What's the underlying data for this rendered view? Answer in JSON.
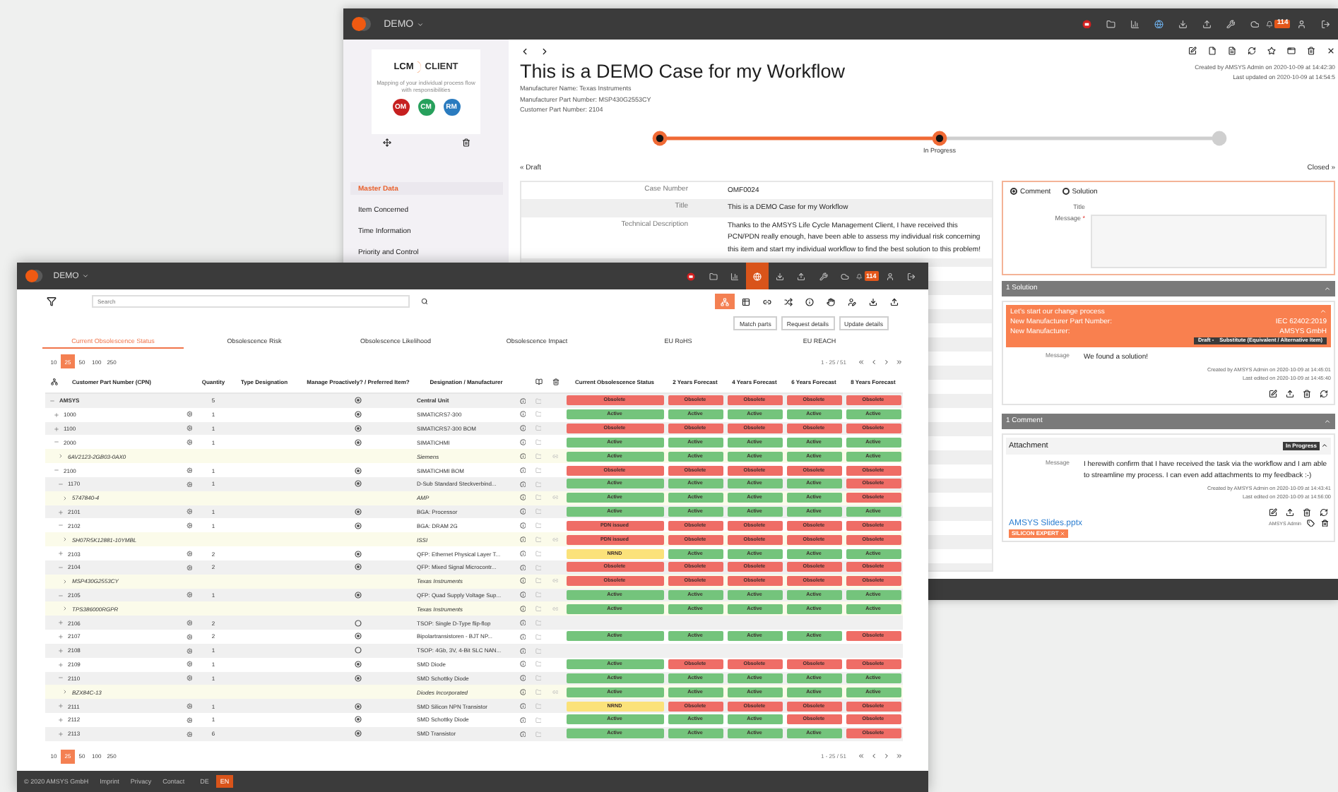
{
  "back_window": {
    "app_name": "DEMO",
    "notifications": "114",
    "logo": {
      "brand": "LCM",
      "product": "CLIENT",
      "tagline": "Mapping of your individual process flow with responsibilities",
      "modules": [
        "OM",
        "CM",
        "RM"
      ]
    },
    "menu": [
      {
        "label": "Master Data",
        "selected": true
      },
      {
        "label": "Item Concerned",
        "selected": false
      },
      {
        "label": "Time Information",
        "selected": false
      },
      {
        "label": "Priority and Control",
        "selected": false
      }
    ],
    "title": "This is a DEMO Case for my Workflow",
    "meta": [
      "Manufacturer Name: Texas Instruments",
      "Manufacturer Part Number: MSP430G2553CY",
      "Customer Part Number: 2104"
    ],
    "audit": [
      "Created by AMSYS Admin on 2020-10-09 at 14:42:30",
      "Last updated on 2020-10-09 at 14:54:5"
    ],
    "stepper": {
      "steps": [
        {
          "done": true
        },
        {
          "done": true,
          "label": "In Progress"
        },
        {
          "done": false
        }
      ],
      "previous": "« Draft",
      "next": "Closed »"
    },
    "details": [
      {
        "label": "Case Number",
        "value": "OMF0024"
      },
      {
        "label": "Title",
        "value": "This is a DEMO Case for my Workflow"
      },
      {
        "label": "Technical Description",
        "value": "Thanks to the AMSYS Life Cycle Management Client, I have received this PCN/PDN really enough, have been able to assess my individual risk concerning this item and start my individual workflow to find the best solution to this problem!"
      }
    ],
    "comment_form": {
      "options": [
        {
          "label": "Comment",
          "selected": true
        },
        {
          "label": "Solution",
          "selected": false
        }
      ],
      "fields": [
        {
          "label": "Title"
        },
        {
          "label": "Message",
          "required_mark": "*"
        }
      ]
    },
    "solutions": {
      "header": "1 Solution",
      "items": [
        {
          "title": "Let's start our change process",
          "fields": [
            {
              "label": "New Manufacturer Part Number:",
              "value": "IEC 62402:2019"
            },
            {
              "label": "New Manufacturer:",
              "value": "AMSYS GmbH"
            }
          ],
          "status": "Draft -",
          "type": "Substitute (Equivalent / Alternative Item)",
          "message_label": "Message",
          "message": "We found a solution!",
          "created": "Created by AMSYS Admin on 2020-10-09 at 14:45:01",
          "edited": "Last edited on 2020-10-09 at 14:45:40"
        }
      ]
    },
    "comments": {
      "header": "1 Comment",
      "items": [
        {
          "title": "Attachment",
          "status": "In Progress",
          "message_label": "Message",
          "message": "I herewith confirm that I have received the task via the workflow and I am able to streamline my process. I can even add attachments to my feedback :-)",
          "created": "Created by AMSYS Admin on 2020-10-09 at 14:43:41",
          "edited": "Last edited on 2020-10-09 at 14:56:00",
          "attachment": {
            "file": "AMSYS Slides.pptx",
            "author": "AMSYS Admin",
            "tag": "SILICON EXPERT"
          }
        }
      ]
    }
  },
  "front_window": {
    "app_name": "DEMO",
    "nav": [
      {
        "selected": false
      },
      {
        "selected": false
      },
      {
        "selected": false
      },
      {
        "selected": true
      },
      {
        "selected": false
      },
      {
        "selected": false
      },
      {
        "selected": false
      },
      {
        "selected": false
      },
      {
        "selected": false,
        "badge": "114"
      },
      {
        "selected": false
      },
      {
        "selected": false
      }
    ],
    "search": {
      "placeholder": "Search"
    },
    "tools": [
      {
        "selected": true
      },
      {
        "selected": false
      },
      {
        "selected": false
      },
      {
        "selected": false
      },
      {
        "selected": false
      },
      {
        "selected": false
      },
      {
        "selected": false
      },
      {
        "selected": false
      },
      {
        "selected": false
      }
    ],
    "actions": [
      "Match parts",
      "Request details",
      "Update details"
    ],
    "tabs": [
      {
        "label": "Current Obsolescence Status",
        "selected": true
      },
      {
        "label": "Obsolescence Risk",
        "selected": false
      },
      {
        "label": "Obsolescence Likelihood",
        "selected": false
      },
      {
        "label": "Obsolescence Impact",
        "selected": false
      },
      {
        "label": "EU RoHS",
        "selected": false
      },
      {
        "label": "EU REACH",
        "selected": false
      }
    ],
    "pagers": [
      {
        "sizes": [
          {
            "label": "10",
            "selected": false
          },
          {
            "label": "25",
            "selected": true
          },
          {
            "label": "50",
            "selected": false
          },
          {
            "label": "100",
            "selected": false
          },
          {
            "label": "250",
            "selected": false
          }
        ],
        "range": "1 - 25 / 51"
      },
      {
        "sizes": [
          {
            "label": "10",
            "selected": false
          },
          {
            "label": "25",
            "selected": true
          },
          {
            "label": "50",
            "selected": false
          },
          {
            "label": "100",
            "selected": false
          },
          {
            "label": "250",
            "selected": false
          }
        ],
        "range": "1 - 25 / 51"
      }
    ],
    "table": {
      "columns": [
        "Customer Part Number (CPN)",
        "Quantity",
        "Type Designation",
        "Manage Proactively? / Preferred Item?",
        "Designation / Manufacturer",
        "Current Obsolescence Status",
        "2 Years Forecast",
        "4 Years Forecast",
        "6 Years Forecast",
        "8 Years Forecast"
      ],
      "rows": [
        {
          "kind": "part",
          "cpn": "AMSYS",
          "expanded": true,
          "quantity": "5",
          "preferred": true,
          "designation": "Central Unit",
          "statuses": [
            {
              "label": "Obsolete",
              "kind": "bad"
            },
            {
              "label": "Obsolete",
              "kind": "bad"
            },
            {
              "label": "Obsolete",
              "kind": "bad"
            },
            {
              "label": "Obsolete",
              "kind": "bad"
            },
            {
              "label": "Obsolete",
              "kind": "bad"
            }
          ],
          "children": [
            {
              "kind": "part",
              "cpn": "1000",
              "expanded": false,
              "quantity": "1",
              "preferred": true,
              "designation": "SIMATICRS7-300",
              "statuses": [
                {
                  "label": "Active",
                  "kind": "good"
                },
                {
                  "label": "Active",
                  "kind": "good"
                },
                {
                  "label": "Active",
                  "kind": "good"
                },
                {
                  "label": "Active",
                  "kind": "good"
                },
                {
                  "label": "Active",
                  "kind": "good"
                }
              ]
            },
            {
              "kind": "part",
              "cpn": "1100",
              "expanded": false,
              "quantity": "1",
              "preferred": true,
              "designation": "SIMATICRS7-300 BOM",
              "statuses": [
                {
                  "label": "Obsolete",
                  "kind": "bad"
                },
                {
                  "label": "Obsolete",
                  "kind": "bad"
                },
                {
                  "label": "Obsolete",
                  "kind": "bad"
                },
                {
                  "label": "Obsolete",
                  "kind": "bad"
                },
                {
                  "label": "Obsolete",
                  "kind": "bad"
                }
              ]
            },
            {
              "kind": "part",
              "cpn": "2000",
              "expanded": true,
              "quantity": "1",
              "preferred": true,
              "designation": "SIMATICHMI",
              "statuses": [
                {
                  "label": "Active",
                  "kind": "good"
                },
                {
                  "label": "Active",
                  "kind": "good"
                },
                {
                  "label": "Active",
                  "kind": "good"
                },
                {
                  "label": "Active",
                  "kind": "good"
                },
                {
                  "label": "Active",
                  "kind": "good"
                }
              ],
              "children": [
                {
                  "kind": "manufacturer",
                  "cpn": "6AV2123-2GB03-0AX0",
                  "designation": "Siemens",
                  "statuses": [
                    {
                      "label": "Active",
                      "kind": "good"
                    },
                    {
                      "label": "Active",
                      "kind": "good"
                    },
                    {
                      "label": "Active",
                      "kind": "good"
                    },
                    {
                      "label": "Active",
                      "kind": "good"
                    },
                    {
                      "label": "Active",
                      "kind": "good"
                    }
                  ]
                }
              ]
            },
            {
              "kind": "part",
              "cpn": "2100",
              "expanded": true,
              "quantity": "1",
              "preferred": true,
              "designation": "SIMATICHMI BOM",
              "statuses": [
                {
                  "label": "Obsolete",
                  "kind": "bad"
                },
                {
                  "label": "Obsolete",
                  "kind": "bad"
                },
                {
                  "label": "Obsolete",
                  "kind": "bad"
                },
                {
                  "label": "Obsolete",
                  "kind": "bad"
                },
                {
                  "label": "Obsolete",
                  "kind": "bad"
                }
              ],
              "children": [
                {
                  "kind": "part",
                  "cpn": "1170",
                  "expanded": true,
                  "quantity": "1",
                  "preferred": true,
                  "designation": "D-Sub Standard Steckverbind...",
                  "statuses": [
                    {
                      "label": "Active",
                      "kind": "good"
                    },
                    {
                      "label": "Active",
                      "kind": "good"
                    },
                    {
                      "label": "Active",
                      "kind": "good"
                    },
                    {
                      "label": "Active",
                      "kind": "good"
                    },
                    {
                      "label": "Obsolete",
                      "kind": "bad"
                    }
                  ],
                  "children": [
                    {
                      "kind": "manufacturer",
                      "cpn": "5747840-4",
                      "designation": "AMP",
                      "statuses": [
                        {
                          "label": "Active",
                          "kind": "good"
                        },
                        {
                          "label": "Active",
                          "kind": "good"
                        },
                        {
                          "label": "Active",
                          "kind": "good"
                        },
                        {
                          "label": "Active",
                          "kind": "good"
                        },
                        {
                          "label": "Obsolete",
                          "kind": "bad"
                        }
                      ]
                    }
                  ]
                },
                {
                  "kind": "part",
                  "cpn": "2101",
                  "expanded": false,
                  "quantity": "1",
                  "preferred": true,
                  "designation": "BGA: Processor",
                  "statuses": [
                    {
                      "label": "Active",
                      "kind": "good"
                    },
                    {
                      "label": "Active",
                      "kind": "good"
                    },
                    {
                      "label": "Active",
                      "kind": "good"
                    },
                    {
                      "label": "Active",
                      "kind": "good"
                    },
                    {
                      "label": "Active",
                      "kind": "good"
                    }
                  ]
                },
                {
                  "kind": "part",
                  "cpn": "2102",
                  "expanded": true,
                  "quantity": "1",
                  "preferred": true,
                  "designation": "BGA: DRAM 2G",
                  "statuses": [
                    {
                      "label": "PDN issued",
                      "kind": "bad"
                    },
                    {
                      "label": "Obsolete",
                      "kind": "bad"
                    },
                    {
                      "label": "Obsolete",
                      "kind": "bad"
                    },
                    {
                      "label": "Obsolete",
                      "kind": "bad"
                    },
                    {
                      "label": "Obsolete",
                      "kind": "bad"
                    }
                  ],
                  "children": [
                    {
                      "kind": "manufacturer",
                      "cpn": "SH07R5K12881-10YMBL",
                      "designation": "ISSI",
                      "statuses": [
                        {
                          "label": "PDN issued",
                          "kind": "bad"
                        },
                        {
                          "label": "Obsolete",
                          "kind": "bad"
                        },
                        {
                          "label": "Obsolete",
                          "kind": "bad"
                        },
                        {
                          "label": "Obsolete",
                          "kind": "bad"
                        },
                        {
                          "label": "Obsolete",
                          "kind": "bad"
                        }
                      ]
                    }
                  ]
                },
                {
                  "kind": "part",
                  "cpn": "2103",
                  "expanded": false,
                  "quantity": "2",
                  "preferred": true,
                  "designation": "QFP: Ethernet Physical Layer T...",
                  "statuses": [
                    {
                      "label": "NRND",
                      "kind": "warn"
                    },
                    {
                      "label": "Active",
                      "kind": "good"
                    },
                    {
                      "label": "Active",
                      "kind": "good"
                    },
                    {
                      "label": "Active",
                      "kind": "good"
                    },
                    {
                      "label": "Active",
                      "kind": "good"
                    }
                  ]
                },
                {
                  "kind": "part",
                  "cpn": "2104",
                  "expanded": true,
                  "quantity": "2",
                  "preferred": true,
                  "designation": "QFP: Mixed Signal Microcontr...",
                  "statuses": [
                    {
                      "label": "Obsolete",
                      "kind": "bad"
                    },
                    {
                      "label": "Obsolete",
                      "kind": "bad"
                    },
                    {
                      "label": "Obsolete",
                      "kind": "bad"
                    },
                    {
                      "label": "Obsolete",
                      "kind": "bad"
                    },
                    {
                      "label": "Obsolete",
                      "kind": "bad"
                    }
                  ],
                  "children": [
                    {
                      "kind": "manufacturer",
                      "cpn": "MSP430G2553CY",
                      "designation": "Texas Instruments",
                      "statuses": [
                        {
                          "label": "Obsolete",
                          "kind": "bad"
                        },
                        {
                          "label": "Obsolete",
                          "kind": "bad"
                        },
                        {
                          "label": "Obsolete",
                          "kind": "bad"
                        },
                        {
                          "label": "Obsolete",
                          "kind": "bad"
                        },
                        {
                          "label": "Obsolete",
                          "kind": "bad"
                        }
                      ]
                    }
                  ]
                },
                {
                  "kind": "part",
                  "cpn": "2105",
                  "expanded": true,
                  "quantity": "1",
                  "preferred": true,
                  "designation": "QFP: Quad Supply Voltage Sup...",
                  "statuses": [
                    {
                      "label": "Active",
                      "kind": "good"
                    },
                    {
                      "label": "Active",
                      "kind": "good"
                    },
                    {
                      "label": "Active",
                      "kind": "good"
                    },
                    {
                      "label": "Active",
                      "kind": "good"
                    },
                    {
                      "label": "Active",
                      "kind": "good"
                    }
                  ],
                  "children": [
                    {
                      "kind": "manufacturer",
                      "cpn": "TPS386000RGPR",
                      "designation": "Texas Instruments",
                      "statuses": [
                        {
                          "label": "Active",
                          "kind": "good"
                        },
                        {
                          "label": "Active",
                          "kind": "good"
                        },
                        {
                          "label": "Active",
                          "kind": "good"
                        },
                        {
                          "label": "Active",
                          "kind": "good"
                        },
                        {
                          "label": "Active",
                          "kind": "good"
                        }
                      ]
                    }
                  ]
                },
                {
                  "kind": "part",
                  "cpn": "2106",
                  "expanded": false,
                  "quantity": "2",
                  "preferred": false,
                  "designation": "TSOP: Single D-Type flip-flop"
                },
                {
                  "kind": "part",
                  "cpn": "2107",
                  "expanded": false,
                  "quantity": "2",
                  "preferred": true,
                  "designation": "Bipolartransistoren - BJT NP...",
                  "statuses": [
                    {
                      "label": "Active",
                      "kind": "good"
                    },
                    {
                      "label": "Active",
                      "kind": "good"
                    },
                    {
                      "label": "Active",
                      "kind": "good"
                    },
                    {
                      "label": "Active",
                      "kind": "good"
                    },
                    {
                      "label": "Obsolete",
                      "kind": "bad"
                    }
                  ]
                },
                {
                  "kind": "part",
                  "cpn": "2108",
                  "expanded": false,
                  "quantity": "1",
                  "preferred": false,
                  "designation": "TSOP: 4Gb, 3V, 4-Bit SLC NAN..."
                },
                {
                  "kind": "part",
                  "cpn": "2109",
                  "expanded": false,
                  "quantity": "1",
                  "preferred": true,
                  "designation": "SMD Diode",
                  "statuses": [
                    {
                      "label": "Active",
                      "kind": "good"
                    },
                    {
                      "label": "Obsolete",
                      "kind": "bad"
                    },
                    {
                      "label": "Obsolete",
                      "kind": "bad"
                    },
                    {
                      "label": "Obsolete",
                      "kind": "bad"
                    },
                    {
                      "label": "Obsolete",
                      "kind": "bad"
                    }
                  ]
                },
                {
                  "kind": "part",
                  "cpn": "2110",
                  "expanded": true,
                  "quantity": "1",
                  "preferred": true,
                  "designation": "SMD Schottky Diode",
                  "statuses": [
                    {
                      "label": "Active",
                      "kind": "good"
                    },
                    {
                      "label": "Active",
                      "kind": "good"
                    },
                    {
                      "label": "Active",
                      "kind": "good"
                    },
                    {
                      "label": "Active",
                      "kind": "good"
                    },
                    {
                      "label": "Active",
                      "kind": "good"
                    }
                  ],
                  "children": [
                    {
                      "kind": "manufacturer",
                      "cpn": "BZX84C-13",
                      "designation": "Diodes Incorporated",
                      "statuses": [
                        {
                          "label": "Active",
                          "kind": "good"
                        },
                        {
                          "label": "Active",
                          "kind": "good"
                        },
                        {
                          "label": "Active",
                          "kind": "good"
                        },
                        {
                          "label": "Active",
                          "kind": "good"
                        },
                        {
                          "label": "Active",
                          "kind": "good"
                        }
                      ]
                    }
                  ]
                },
                {
                  "kind": "part",
                  "cpn": "2111",
                  "expanded": false,
                  "quantity": "1",
                  "preferred": true,
                  "designation": "SMD Silicon NPN Transistor",
                  "statuses": [
                    {
                      "label": "NRND",
                      "kind": "warn"
                    },
                    {
                      "label": "Obsolete",
                      "kind": "bad"
                    },
                    {
                      "label": "Obsolete",
                      "kind": "bad"
                    },
                    {
                      "label": "Obsolete",
                      "kind": "bad"
                    },
                    {
                      "label": "Obsolete",
                      "kind": "bad"
                    }
                  ]
                },
                {
                  "kind": "part",
                  "cpn": "2112",
                  "expanded": false,
                  "quantity": "1",
                  "preferred": true,
                  "designation": "SMD Schottky Diode",
                  "statuses": [
                    {
                      "label": "Active",
                      "kind": "good"
                    },
                    {
                      "label": "Active",
                      "kind": "good"
                    },
                    {
                      "label": "Active",
                      "kind": "good"
                    },
                    {
                      "label": "Obsolete",
                      "kind": "bad"
                    },
                    {
                      "label": "Obsolete",
                      "kind": "bad"
                    }
                  ]
                },
                {
                  "kind": "part",
                  "cpn": "2113",
                  "expanded": false,
                  "quantity": "6",
                  "preferred": true,
                  "designation": "SMD Transistor",
                  "statuses": [
                    {
                      "label": "Active",
                      "kind": "good"
                    },
                    {
                      "label": "Active",
                      "kind": "good"
                    },
                    {
                      "label": "Active",
                      "kind": "good"
                    },
                    {
                      "label": "Active",
                      "kind": "good"
                    },
                    {
                      "label": "Obsolete",
                      "kind": "bad"
                    }
                  ]
                }
              ]
            }
          ]
        }
      ]
    },
    "footer": {
      "copyright": "© 2020 AMSYS GmbH",
      "links": [
        "Imprint",
        "Privacy",
        "Contact"
      ],
      "languages": [
        {
          "label": "DE",
          "selected": false
        },
        {
          "label": "EN",
          "selected": true
        }
      ]
    }
  }
}
